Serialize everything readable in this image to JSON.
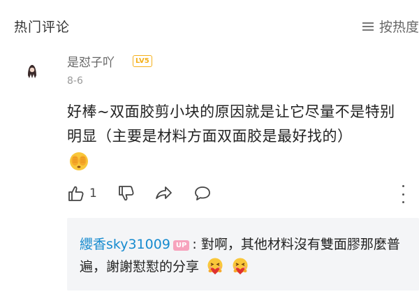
{
  "header": {
    "title": "热门评论",
    "sort_label": "按热度"
  },
  "comment": {
    "username": "是怼子吖",
    "level_badge": "LV5",
    "date": "8-6",
    "content": "好棒~双面胶剪小块的原因就是让它尽量不是特别明显（主要是材料方面双面胶是最好找的）",
    "emoji": "covering-face-emoji",
    "like_count": "1",
    "badge_color": "#f5b01a"
  },
  "reply": {
    "username": "纓香sky31009",
    "up_badge": "UP",
    "separator": ":",
    "text": "對啊，其他材料沒有雙面膠那麼普遍，謝謝懟懟的分享",
    "emojis": [
      "heart-hug-emoji",
      "heart-hug-emoji"
    ],
    "username_color": "#178bcf",
    "up_badge_color": "#f7a3bd"
  }
}
